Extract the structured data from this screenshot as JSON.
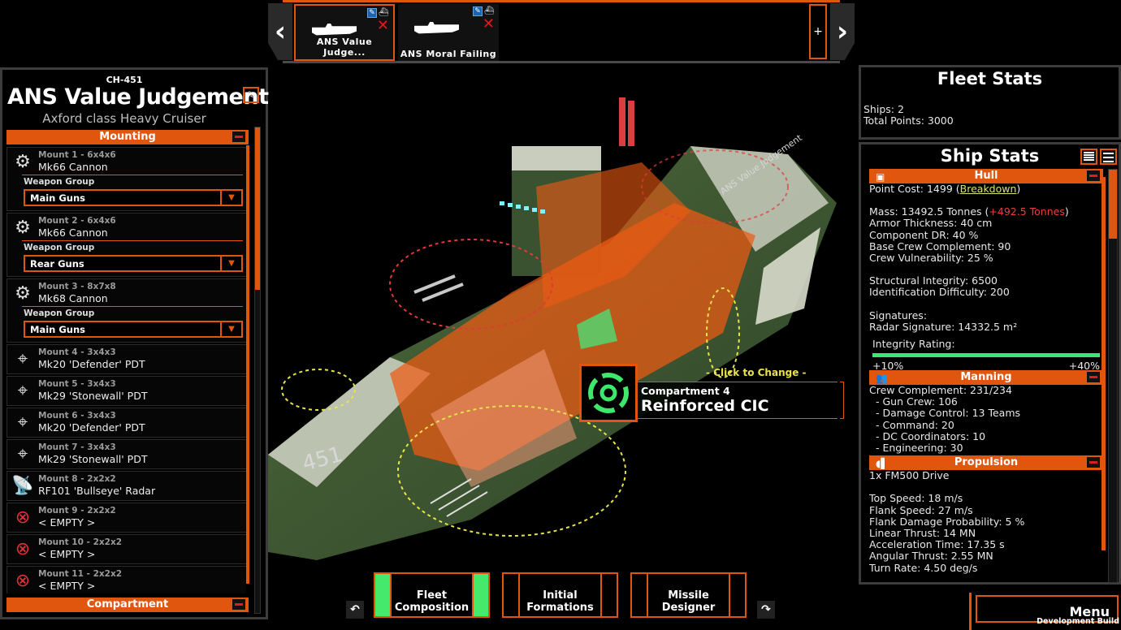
{
  "colors": {
    "accent": "#e0560f",
    "panel_border": "#3c3c3c",
    "active_green": "#45ea6c",
    "warning_red": "#e8403a",
    "link_yellow": "#d9e36a",
    "hint_yellow": "#e8e34a"
  },
  "ship_bar": {
    "prev_icon": "chevron-left-icon",
    "next_icon": "chevron-right-icon",
    "add_label": "+",
    "ships": [
      {
        "name": "ANS Value Judge...",
        "selected": true,
        "edit_icon": "edit-icon",
        "fleet_icon": "fleet-icon",
        "remove_icon": "remove-icon"
      },
      {
        "name": "ANS Moral Failing",
        "selected": false,
        "edit_icon": "edit-icon",
        "fleet_icon": "fleet-icon",
        "remove_icon": "remove-icon"
      }
    ]
  },
  "left_panel": {
    "hull_code": "CH-451",
    "ship_name": "ANS Value Judgement",
    "rename_icon": "edit-icon",
    "ship_class": "Axford class Heavy Cruiser",
    "mounting_header": "Mounting",
    "compartment_header": "Compartment",
    "weapon_group_label": "Weapon Group",
    "mounts": [
      {
        "title": "Mount 1 - 6x4x6",
        "component": "Mk66 Cannon",
        "type": "cannon",
        "weapon_group": "Main Guns"
      },
      {
        "title": "Mount 2 - 6x4x6",
        "component": "Mk66 Cannon",
        "type": "cannon",
        "weapon_group": "Rear Guns"
      },
      {
        "title": "Mount 3 - 8x7x8",
        "component": "Mk68 Cannon",
        "type": "cannon",
        "weapon_group": "Main Guns"
      },
      {
        "title": "Mount 4 - 3x4x3",
        "component": "Mk20 'Defender' PDT",
        "type": "pdt"
      },
      {
        "title": "Mount 5 - 3x4x3",
        "component": "Mk29 'Stonewall' PDT",
        "type": "pdt"
      },
      {
        "title": "Mount 6 - 3x4x3",
        "component": "Mk20 'Defender' PDT",
        "type": "pdt"
      },
      {
        "title": "Mount 7 - 3x4x3",
        "component": "Mk29 'Stonewall' PDT",
        "type": "pdt"
      },
      {
        "title": "Mount 8 - 2x2x2",
        "component": "RF101 'Bullseye' Radar",
        "type": "radar"
      },
      {
        "title": "Mount 9 - 2x2x2",
        "component": "< EMPTY >",
        "type": "empty"
      },
      {
        "title": "Mount 10 - 2x2x2",
        "component": "< EMPTY >",
        "type": "empty"
      },
      {
        "title": "Mount 11 - 2x2x2",
        "component": "< EMPTY >",
        "type": "empty"
      }
    ]
  },
  "fleet_stats": {
    "title": "Fleet Stats",
    "ships_line": "Ships: 2",
    "points_line": "Total Points: 3000"
  },
  "ship_stats": {
    "title": "Ship Stats",
    "hull": {
      "header": "Hull",
      "point_cost_prefix": "Point Cost: 1499 (",
      "breakdown_link": "Breakdown",
      "point_cost_suffix": ")",
      "mass_prefix": "Mass: 13492.5 Tonnes (",
      "mass_delta": "+492.5 Tonnes",
      "mass_suffix": ")",
      "lines_a": [
        "Armor Thickness: 40 cm",
        "Component DR: 40 %",
        "Base Crew Complement: 90",
        "Crew Vulnerability: 25 %"
      ],
      "lines_b": [
        "Structural Integrity: 6500",
        "Identification Difficulty: 200"
      ],
      "lines_c": [
        "Signatures:",
        "Radar Signature: 14332.5 m²"
      ],
      "integrity_label": "Integrity Rating:",
      "integrity_fill": 1.0,
      "integrity_low": "+10%",
      "integrity_high": "+40%"
    },
    "manning": {
      "header": "Manning",
      "lines": [
        "Crew Complement: 231/234"
      ],
      "sub_lines": [
        "- Gun Crew: 106",
        "- Damage Control: 13 Teams",
        "- Command: 20",
        "- DC Coordinators: 10",
        "- Engineering: 30"
      ]
    },
    "propulsion": {
      "header": "Propulsion",
      "drive": "1x FM500 Drive",
      "lines": [
        "Top Speed: 18 m/s",
        "Flank Speed: 27 m/s",
        "Flank Damage Probability: 5 %",
        "Linear Thrust: 14 MN",
        "Acceleration Time: 17.35 s",
        "Angular Thrust: 2.55 MN",
        "Turn Rate: 4.50 deg/s"
      ]
    }
  },
  "viewport": {
    "hull_number": "451",
    "hull_name_decal": "ANS Value Judgement"
  },
  "compartment_popup": {
    "hint": "- Click to Change -",
    "number": "Compartment 4",
    "name": "Reinforced CIC",
    "icon": "cic-icon"
  },
  "bottom_nav": {
    "undo_icon": "undo-icon",
    "redo_icon": "redo-icon",
    "buttons": [
      {
        "label_1": "Fleet",
        "label_2": "Composition",
        "active": true
      },
      {
        "label_1": "Initial",
        "label_2": "Formations",
        "active": false
      },
      {
        "label_1": "Missile",
        "label_2": "Designer",
        "active": false
      }
    ]
  },
  "menu": {
    "label": "Menu",
    "build": "Development Build"
  }
}
